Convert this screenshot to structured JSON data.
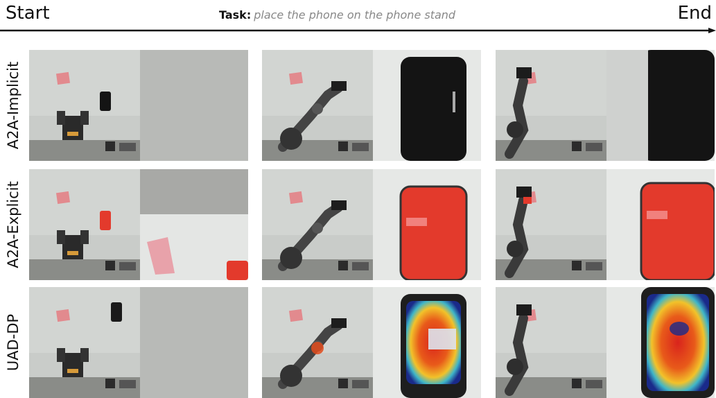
{
  "header": {
    "start": "Start",
    "end": "End",
    "task_label": "Task:",
    "task_text": "place the phone on the phone stand"
  },
  "rows": [
    {
      "label": "A2A-Implicit",
      "phone_color": "#141414",
      "overlay": "none"
    },
    {
      "label": "A2A-Explicit",
      "phone_color": "#e33a2c",
      "overlay": "red"
    },
    {
      "label": "UAD-DP",
      "phone_color": "#1a1a1a",
      "overlay": "heatmap"
    }
  ],
  "columns": 3
}
